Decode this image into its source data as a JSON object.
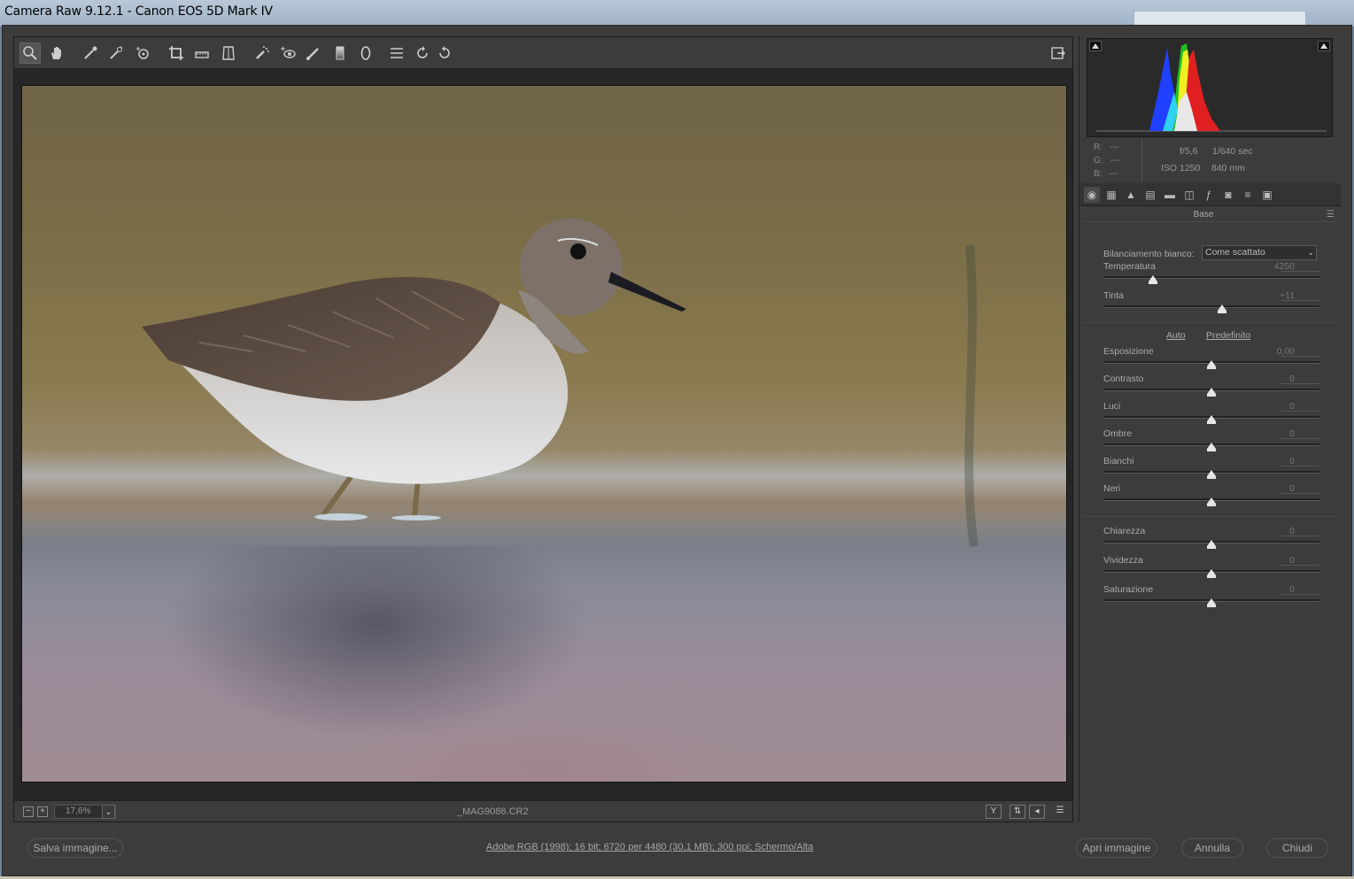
{
  "window": {
    "title": "Camera Raw 9.12.1  -  Canon EOS 5D Mark IV"
  },
  "toolbar": {
    "tools": [
      "zoom-icon",
      "hand-icon",
      "white-balance-icon",
      "color-sampler-icon",
      "target-adjust-icon",
      "crop-icon",
      "straighten-icon",
      "transform-icon",
      "spot-removal-icon",
      "red-eye-icon",
      "adjustment-brush-icon",
      "graduated-filter-icon",
      "radial-filter-icon",
      "preferences-icon",
      "rotate-left-icon",
      "rotate-right-icon"
    ],
    "fullscreen": "fullscreen-icon"
  },
  "preview": {
    "zoom": "17,6%",
    "filename": "_MAG9086.CR2"
  },
  "info": {
    "r_label": "R:",
    "g_label": "G:",
    "b_label": "B:",
    "r": "---",
    "g": "---",
    "b": "---",
    "aperture": "f/5,6",
    "shutter": "1/640 sec",
    "iso": "ISO 1250",
    "focal": "840 mm"
  },
  "panel": {
    "title": "Base",
    "wb_label": "Bilanciamento bianco:",
    "wb_value": "Come scattato",
    "auto": "Auto",
    "default": "Predefinito",
    "sliders": [
      {
        "label": "Temperatura",
        "value": "4250",
        "pos": 0.23
      },
      {
        "label": "Tinta",
        "value": "+11",
        "pos": 0.55
      },
      {
        "label": "Esposizione",
        "value": "0,00",
        "pos": 0.5
      },
      {
        "label": "Contrasto",
        "value": "0",
        "pos": 0.5
      },
      {
        "label": "Luci",
        "value": "0",
        "pos": 0.5
      },
      {
        "label": "Ombre",
        "value": "0",
        "pos": 0.5
      },
      {
        "label": "Bianchi",
        "value": "0",
        "pos": 0.5
      },
      {
        "label": "Neri",
        "value": "0",
        "pos": 0.5
      },
      {
        "label": "Chiarezza",
        "value": "0",
        "pos": 0.5
      },
      {
        "label": "Vividezza",
        "value": "0",
        "pos": 0.5
      },
      {
        "label": "Saturazione",
        "value": "0",
        "pos": 0.5
      }
    ]
  },
  "footer": {
    "save": "Salva immagine...",
    "info": "Adobe RGB (1998); 16 bit; 6720 per 4480 (30,1 MB); 300 ppi; Schermo/Alta",
    "open": "Apri immagine",
    "cancel": "Annulla",
    "done": "Chiudi"
  },
  "colors": {
    "panel_bg": "#3c3c3c",
    "histogram_red": "#e02020",
    "histogram_green": "#20c020",
    "histogram_blue": "#2040ff",
    "histogram_yellow": "#f0f020"
  }
}
